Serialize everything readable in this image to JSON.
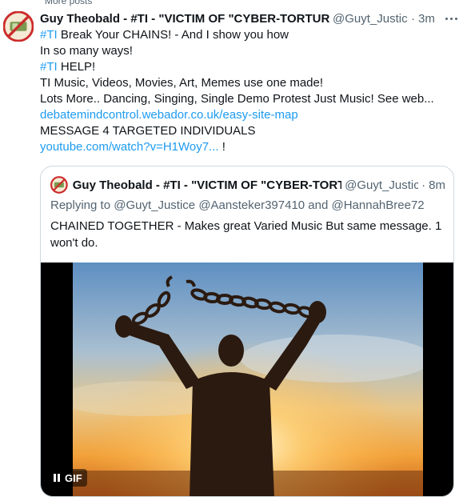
{
  "context": {
    "label": "More posts"
  },
  "tweet": {
    "author_name": "Guy Theobald - #TI - \"VICTIM OF \"CYBER-TORTUR",
    "handle": "@Guyt_Justic•",
    "separator": "·",
    "time": "3m",
    "lines": {
      "l1_tag": "#TI",
      "l1_text": " Break Your CHAINS! - And I show you how",
      "l2": "In so many ways!",
      "l3_tag": "#TI",
      "l3_text": " HELP!",
      "l4": "TI Music, Videos, Movies, Art, Memes use one made!",
      "l5": "Lots More.. Dancing, Singing, Single Demo Protest Just Music! See web...",
      "l6_link": "debatemindcontrol.webador.co.uk/easy-site-map",
      "l7": "MESSAGE 4 TARGETED INDIVIDUALS",
      "l8_link": "youtube.com/watch?v=H1Woy7...",
      "l8_tail": " !"
    }
  },
  "quote": {
    "author_name": "Guy Theobald - #TI - \"VICTIM OF \"CYBER-TORT",
    "handle": "@Guyt_Justic•",
    "separator": "·",
    "time": "8m",
    "replying_prefix": "Replying to ",
    "replying_to": "@Guyt_Justice @Aansteker397410 and @HannahBree72",
    "text": "CHAINED TOGETHER - Makes great Varied Music But same message. 1 won't do.",
    "media": {
      "type": "gif",
      "badge": "GIF",
      "state": "playing",
      "control_icon": "pause-icon"
    }
  },
  "colors": {
    "accent": "#1d9bf0",
    "secondary_text": "#536471",
    "border": "#cfd9de"
  }
}
